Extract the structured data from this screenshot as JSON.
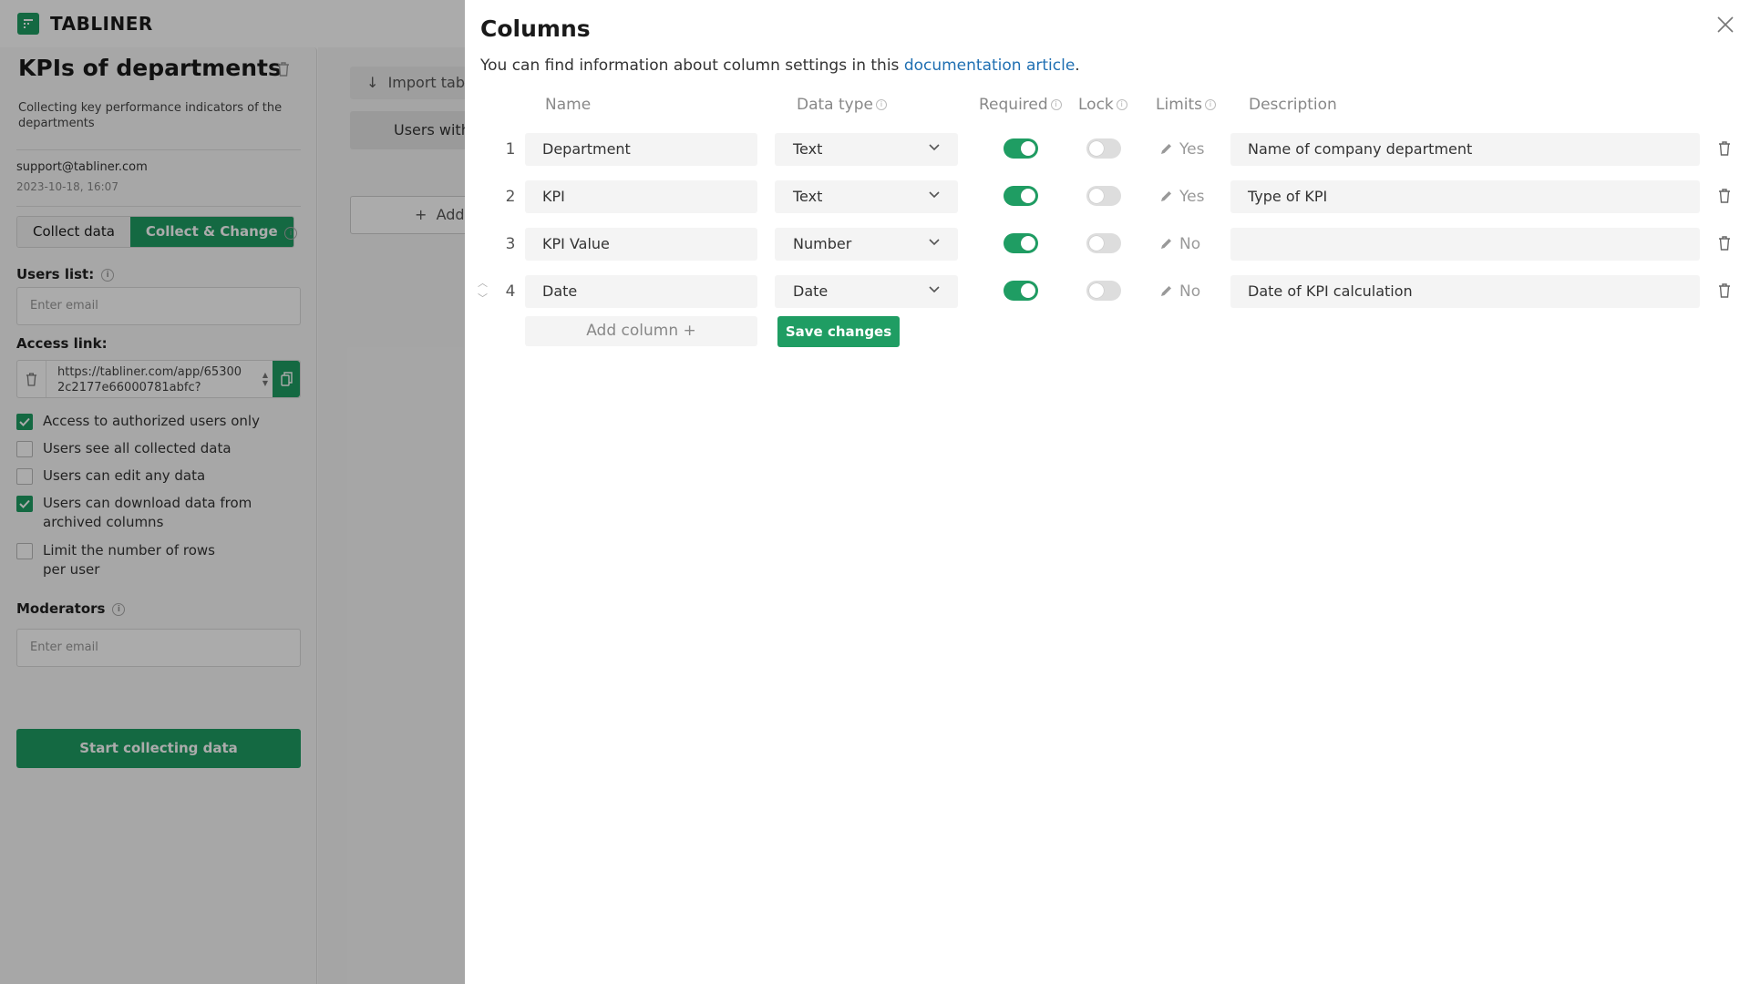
{
  "app": {
    "brand": "TABLINER",
    "colors": {
      "accent": "#1f9d63",
      "link": "#1f6fb2"
    }
  },
  "sidebar": {
    "title": "KPIs of departments",
    "description": "Collecting key performance indicators of the departments",
    "email": "support@tabliner.com",
    "date": "2023-10-18, 16:07",
    "modes": [
      "Collect data",
      "Collect & Change"
    ],
    "active_mode": "Collect & Change",
    "users_list_label": "Users list:",
    "users_placeholder": "Enter email",
    "access_link_label": "Access link:",
    "access_link": "https://tabliner.com/app/653002c2177e66000781abfc?",
    "access_link_line1": "https://tabliner.com/app/65300",
    "access_link_line2": "2c2177e66000781abfc?",
    "checkboxes": [
      {
        "label": "Access to authorized users only",
        "checked": true
      },
      {
        "label": "Users see all collected data",
        "checked": false
      },
      {
        "label": "Users can edit any data",
        "checked": false
      },
      {
        "label": "Users can download data from archived columns",
        "line1": "Users can download data from",
        "line2": "archived columns",
        "checked": true
      },
      {
        "label": "Limit the number of rows per user",
        "line1": "Limit the number of rows",
        "line2": "per user",
        "checked": false
      }
    ],
    "moderators_label": "Moderators",
    "moderators_placeholder": "Enter email",
    "start_button": "Start collecting data"
  },
  "main": {
    "import_button": "Import tab",
    "users_tab": "Users with",
    "add_button": "Add"
  },
  "modal": {
    "title": "Columns",
    "subtitle_prefix": "You can find information about column settings in this ",
    "subtitle_link": "documentation article",
    "subtitle_suffix": ".",
    "headers": {
      "name": "Name",
      "data_type": "Data type",
      "required": "Required",
      "lock": "Lock",
      "limits": "Limits",
      "description": "Description"
    },
    "rows": [
      {
        "num": "1",
        "name": "Department",
        "type": "Text",
        "required": true,
        "lock": false,
        "limits": "Yes",
        "description": "Name of company department"
      },
      {
        "num": "2",
        "name": "KPI",
        "type": "Text",
        "required": true,
        "lock": false,
        "limits": "Yes",
        "description": "Type of KPI"
      },
      {
        "num": "3",
        "name": "KPI Value",
        "type": "Number",
        "required": true,
        "lock": false,
        "limits": "No",
        "description": ""
      },
      {
        "num": "4",
        "name": "Date",
        "type": "Date",
        "required": true,
        "lock": false,
        "limits": "No",
        "description": "Date of KPI calculation"
      }
    ],
    "add_column": "Add column +",
    "save_button": "Save changes",
    "icons": [
      "close-icon",
      "trash-icon",
      "pencil-icon",
      "chevron-down-icon",
      "info-icon",
      "copy-icon",
      "checkmark-icon"
    ]
  }
}
